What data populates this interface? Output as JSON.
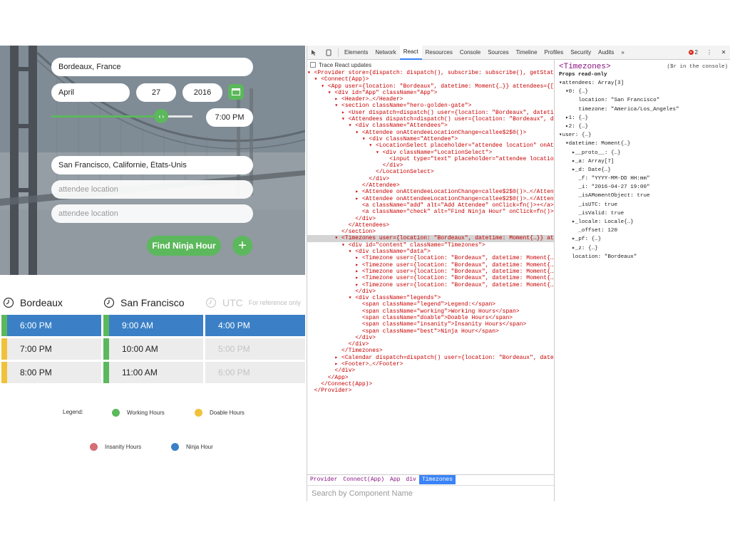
{
  "app": {
    "location": "Bordeaux, France",
    "month": "April",
    "day": "27",
    "year": "2016",
    "time": "7:00 PM",
    "slider_level": 0.78,
    "attendees": [
      {
        "value": "San Francisco, Californie, États-Unis",
        "placeholder": "attendee location"
      },
      {
        "value": "",
        "placeholder": "attendee location"
      },
      {
        "value": "",
        "placeholder": "attendee location"
      }
    ],
    "find_label": "Find Ninja Hour",
    "add_label": "+",
    "columns": [
      {
        "name": "Bordeaux",
        "ref": "",
        "times": [
          "6:00 PM",
          "7:00 PM",
          "8:00 PM"
        ],
        "bars": [
          "#5cb85c",
          "#f0c23b",
          "#f0c23b"
        ]
      },
      {
        "name": "San Francisco",
        "ref": "",
        "times": [
          "9:00 AM",
          "10:00 AM",
          "11:00 AM"
        ],
        "bars": [
          "#5cb85c",
          "#5cb85c",
          "#5cb85c"
        ]
      },
      {
        "name": "UTC",
        "ref": "For reference only",
        "times": [
          "4:00 PM",
          "5:00 PM",
          "6:00 PM"
        ],
        "bars": [
          "",
          "",
          ""
        ]
      }
    ],
    "legend": {
      "title": "Legend:",
      "working": "Working Hours",
      "doable": "Doable Hours",
      "insanity": "Insanity Hours",
      "ninja": "Ninja Hour"
    },
    "colors": {
      "accent": "#5cb85c",
      "selected": "#3b80c6",
      "doable": "#f0c23b",
      "insanity": "#d46f75"
    }
  },
  "devtools": {
    "tabs": [
      "Elements",
      "Network",
      "React",
      "Resources",
      "Console",
      "Sources",
      "Timeline",
      "Profiles",
      "Security",
      "Audits"
    ],
    "more": "»",
    "error_count": "2",
    "trace_label": "Trace React updates",
    "tree": [
      "▾ <Provider store={dispatch: dispatch(), subscribe: subscribe(), getState:",
      "  ▾ <Connect(App)>",
      "    ▾ <App user={location: \"Bordeaux\", datetime: Moment{…}} attendees={[…],",
      "      ▾ <div id=\"App\" className=\"App\">",
      "        ▸ <Header>…</Header>",
      "        ▾ <section className=\"hero-golden-gate\">",
      "          ▸ <User dispatch=dispatch() user={location: \"Bordeaux\", datetime: M",
      "          ▾ <Attendees dispatch=dispatch() user={location: \"Bordeaux\", datet",
      "            ▾ <div className=\"Attendees\">",
      "              ▾ <Attendee onAttendeeLocationChange=callee$2$0()>",
      "                ▾ <div className=\"Attendee\">",
      "                  ▾ <LocationSelect placeholder=\"attendee location\" onAttendee",
      "                    ▾ <div className=\"LocationSelect\">",
      "                        <input type=\"text\" placeholder=\"attendee location\"/>",
      "                      </div>",
      "                    </LocationSelect>",
      "                  </div>",
      "                </Attendee>",
      "              ▸ <Attendee onAttendeeLocationChange=callee$2$0()>…</Attendee>",
      "              ▸ <Attendee onAttendeeLocationChange=callee$2$0()>…</Attendee>",
      "                <a className=\"add\" alt=\"Add Attendee\" onClick=fn()>+</a>",
      "                <a className=\"check\" alt=\"Find Ninja Hour\" onClick=fn()>Find N",
      "              </div>",
      "            </Attendees>",
      "          </section>",
      "        ▾ <Timezones user={location: \"Bordeaux\", datetime: Moment{…}} attend",
      "          ▾ <div id=\"content\" className=\"Timezones\">",
      "            ▾ <div className=\"data\">",
      "              ▸ <Timezone user={location: \"Bordeaux\", datetime: Moment{…}} att",
      "              ▸ <Timezone user={location: \"Bordeaux\", datetime: Moment{…}} att",
      "              ▸ <Timezone user={location: \"Bordeaux\", datetime: Moment{…}} att",
      "              ▸ <Timezone user={location: \"Bordeaux\", datetime: Moment{…}} att",
      "              ▸ <Timezone user={location: \"Bordeaux\", datetime: Moment{…}} att",
      "              </div>",
      "            ▾ <div className=\"legends\">",
      "                <span className=\"legend\">Legend:</span>",
      "                <span className=\"working\">Working Hours</span>",
      "                <span className=\"doable\">Doable Hours</span>",
      "                <span className=\"insanity\">Insanity Hours</span>",
      "                <span className=\"best\">Ninja Hour</span>",
      "              </div>",
      "            </div>",
      "          </Timezones>",
      "        ▸ <Calendar dispatch=dispatch() user={location: \"Bordeaux\", datetime",
      "        ▸ <Footer>…</Footer>",
      "        </div>",
      "      </App>",
      "    </Connect(App)>",
      "  </Provider>"
    ],
    "highlight_index": 25,
    "breadcrumbs": [
      "Provider",
      "Connect(App)",
      "App",
      "div",
      "Timezones"
    ],
    "active_breadcrumb": 4,
    "search_placeholder": "Search by Component Name",
    "props": {
      "component": "<Timezones>",
      "hint": "($r in the console)",
      "title": "Props read-only",
      "lines": [
        "▾attendees: Array[3]",
        "  ▾0: {…}",
        "      location: \"San Francisco\"",
        "      timezone: \"America/Los_Angeles\"",
        "  ▸1: {…}",
        "  ▸2: {…}",
        "▾user: {…}",
        "  ▾datetime: Moment{…}",
        "    ▸__proto__: {…}",
        "    ▸_a: Array[7]",
        "    ▸_d: Date{…}",
        "      _f: \"YYYY-MM-DD HH:mm\"",
        "      _i: \"2016-04-27 19:00\"",
        "      _isAMomentObject: true",
        "      _isUTC: true",
        "      _isValid: true",
        "    ▸_locale: Locale{…}",
        "      _offset: 120",
        "    ▸_pf: {…}",
        "    ▸_z: {…}",
        "    location: \"Bordeaux\""
      ]
    }
  }
}
